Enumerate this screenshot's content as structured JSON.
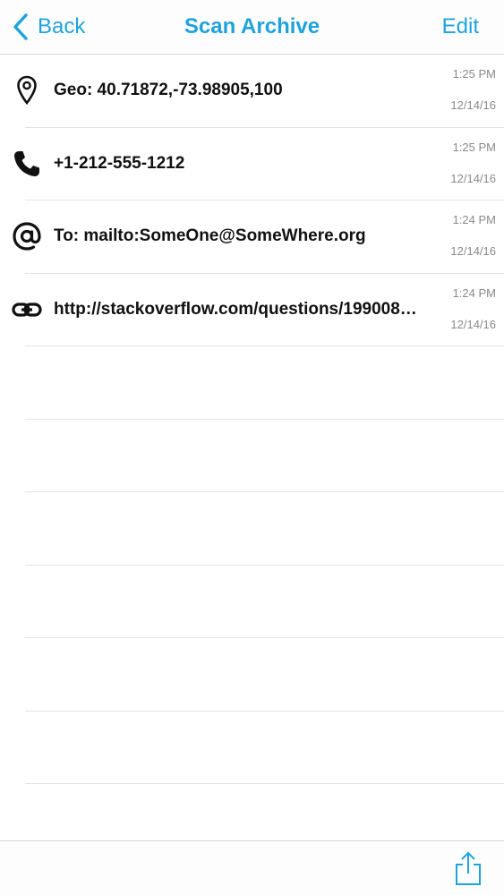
{
  "nav": {
    "back_label": "Back",
    "title": "Scan Archive",
    "edit_label": "Edit"
  },
  "items": [
    {
      "icon": "location-pin-icon",
      "text": "Geo: 40.71872,-73.98905,100",
      "time": "1:25 PM",
      "date": "12/14/16"
    },
    {
      "icon": "phone-icon",
      "text": "+1-212-555-1212",
      "time": "1:25 PM",
      "date": "12/14/16"
    },
    {
      "icon": "at-sign-icon",
      "text": "To: mailto:SomeOne@SomeWhere.org",
      "time": "1:24 PM",
      "date": "12/14/16"
    },
    {
      "icon": "link-icon",
      "text": "http://stackoverflow.com/questions/199008…",
      "time": "1:24 PM",
      "date": "12/14/16"
    }
  ],
  "colors": {
    "accent": "#1fa3dc",
    "text": "#111111",
    "secondary_text": "#8a8a8a",
    "separator": "#e3e3e3"
  },
  "toolbar": {
    "share_icon": "share-icon"
  }
}
